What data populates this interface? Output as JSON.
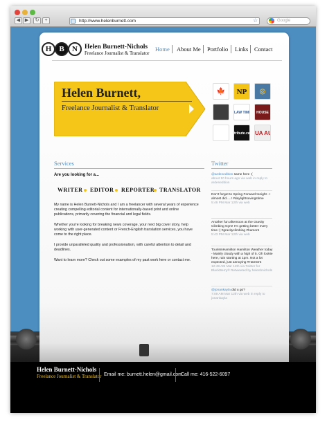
{
  "browser": {
    "url": "http://www.helenburnett.com",
    "search_placeholder": "Google",
    "back_glyph": "◀",
    "forward_glyph": "▶",
    "reload_glyph": "↻",
    "add_glyph": "+"
  },
  "header": {
    "logo_letters": [
      "H",
      "B",
      "N"
    ],
    "logo_name": "Helen Burnett-Nichols",
    "logo_tagline": "Freelance Journalist & Translator",
    "nav": [
      "Home",
      "About Me",
      "Portfolio",
      "Links",
      "Contact"
    ],
    "active_nav": "Home"
  },
  "banner": {
    "title": "Helen Burnett,",
    "subtitle": "Freelance Journalist & Translator",
    "logos": [
      {
        "label": "",
        "bg": "#ffffff",
        "fg": "#c0191d",
        "glyph": "🍁"
      },
      {
        "label": "NP",
        "bg": "#f3c316",
        "fg": "#111111",
        "glyph": ""
      },
      {
        "label": "",
        "bg": "#4a7aa3",
        "fg": "#e8b93b",
        "glyph": "◎"
      },
      {
        "label": "",
        "bg": "#3d3d3d",
        "fg": "#ffffff",
        "glyph": ""
      },
      {
        "label": "LAW TIMES",
        "bg": "#ffffff",
        "fg": "#355a8c",
        "glyph": ""
      },
      {
        "label": "HOUSE",
        "bg": "#7a1b1b",
        "fg": "#ffffff",
        "glyph": ""
      },
      {
        "label": "",
        "bg": "#ffffff",
        "fg": "#6aa33a",
        "glyph": ""
      },
      {
        "label": "tribute.ca",
        "bg": "#111111",
        "fg": "#ffffff",
        "glyph": ""
      },
      {
        "label": "UA AU",
        "bg": "#eeeeee",
        "fg": "#c0191d",
        "glyph": ""
      }
    ]
  },
  "services": {
    "title": "Services",
    "looking_for": "Are you looking for a...",
    "roles": [
      "WRITER",
      "EDITOR",
      "REPORTER",
      "TRANSLATOR"
    ],
    "paragraphs": [
      "My name is Helen Burnett-Nichols and I am a freelancer with several years of experience creating compelling editorial content for internationally-based print and online publications, primarily covering the financial and legal fields.",
      "Whether you're looking for breaking news coverage, your next big cover story, help working with user-generated content or French-English translation services, you have come to the right place.",
      "I provide unparalleled quality and professionalism, with careful attention to detail and deadlines.",
      "Want to learn more? Check out some examples of my past work here or contact me."
    ]
  },
  "twitter": {
    "title": "Twitter",
    "tweets": [
      {
        "user": "@ardenedition",
        "text": "same here :(",
        "meta": "about 10 hours ago via web in reply to ardenedition"
      },
      {
        "user": "",
        "text": "Don't forget to Spring Forward tonight - I almost did.....! #daylightsavingstime",
        "meta": "5:46 PM Mar 12th via web"
      },
      {
        "user": "",
        "text": "Another fun afternoon at the Gravity Climbing Gym! I'm getting better every time :) #gravityclimbing #hamont",
        "meta": "5:43 PM Mar 12th via web"
      },
      {
        "user": "",
        "text": "TourismHamilton Hamilton Weather today - Mainly cloudy with a high of 5. Oh lookie here, rain starting at 1pm. Not a lot expected, just annoying #HamOnt",
        "meta": "12:49 AM Mar 12th via Twitter for BlackBerry® Retweeted by helenbnichols"
      },
      {
        "user": "@jonankayla",
        "text": "did u go?",
        "meta": "7:09 AM Mar 12th via web in reply to jonankayla"
      }
    ]
  },
  "footer": {
    "name": "Helen Burnett-Nichols",
    "tagline": "Freelance Journalist & Translator",
    "email": "Email me: burnett.helen@gmail.com",
    "phone": "Call me: 416-522-6097"
  },
  "colors": {
    "accent_blue": "#4a8ac0",
    "accent_yellow": "#f3c316",
    "background_blue": "#4d8ec1"
  }
}
